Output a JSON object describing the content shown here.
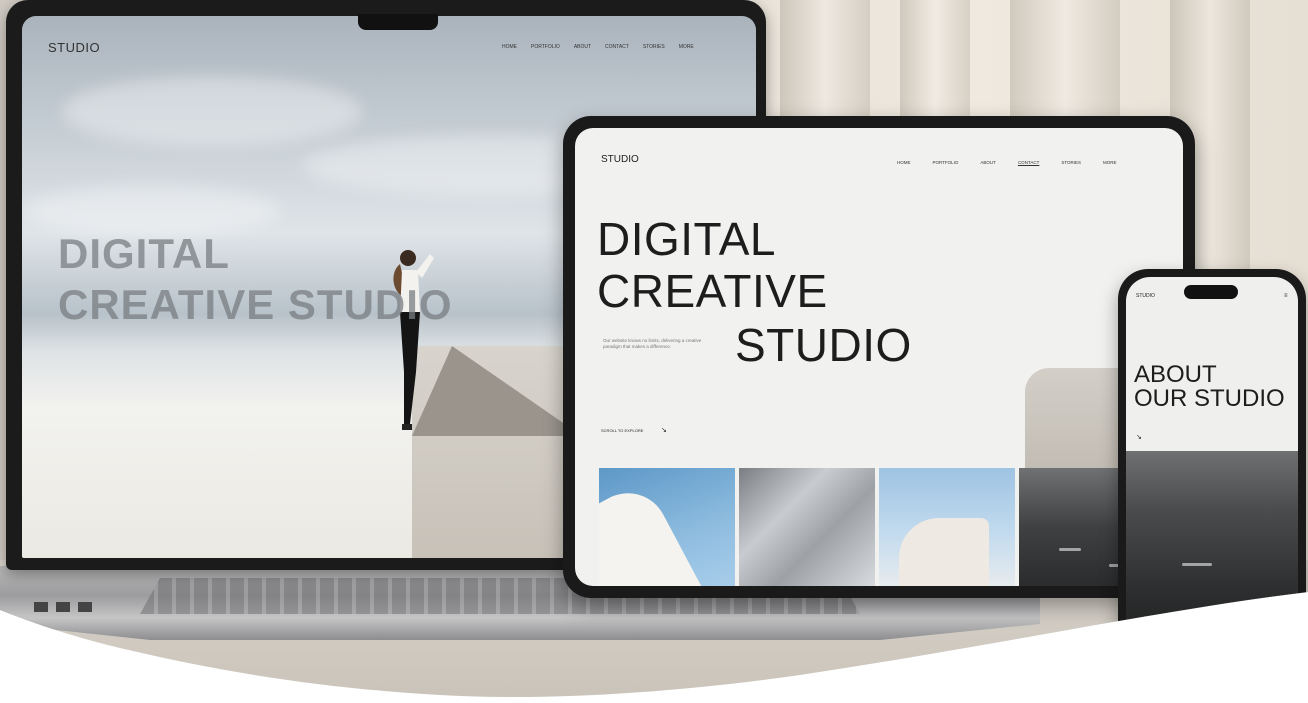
{
  "laptop": {
    "brand": "STUDIO",
    "nav": [
      "HOME",
      "PORTFOLIO",
      "ABOUT",
      "CONTACT",
      "STORIES",
      "MORE"
    ],
    "hero_line1": "DIGITAL",
    "hero_line2": "CREATIVE STUDIO"
  },
  "tablet": {
    "brand": "STUDIO",
    "nav": [
      "HOME",
      "PORTFOLIO",
      "ABOUT",
      "CONTACT",
      "STORIES",
      "MORE"
    ],
    "active_nav": "CONTACT",
    "hero_line1": "DIGITAL",
    "hero_line2": "CREATIVE",
    "hero_line3": "STUDIO",
    "description": "Our website knows no limits, delivering a creative paradigm that makes a difference.",
    "cta": "SCROLL TO EXPLORE",
    "cta_arrow": "↘"
  },
  "phone": {
    "brand": "STUDIO",
    "menu": "≡",
    "hero_line1": "ABOUT",
    "hero_line2": "OUR STUDIO",
    "arrow": "↘"
  }
}
